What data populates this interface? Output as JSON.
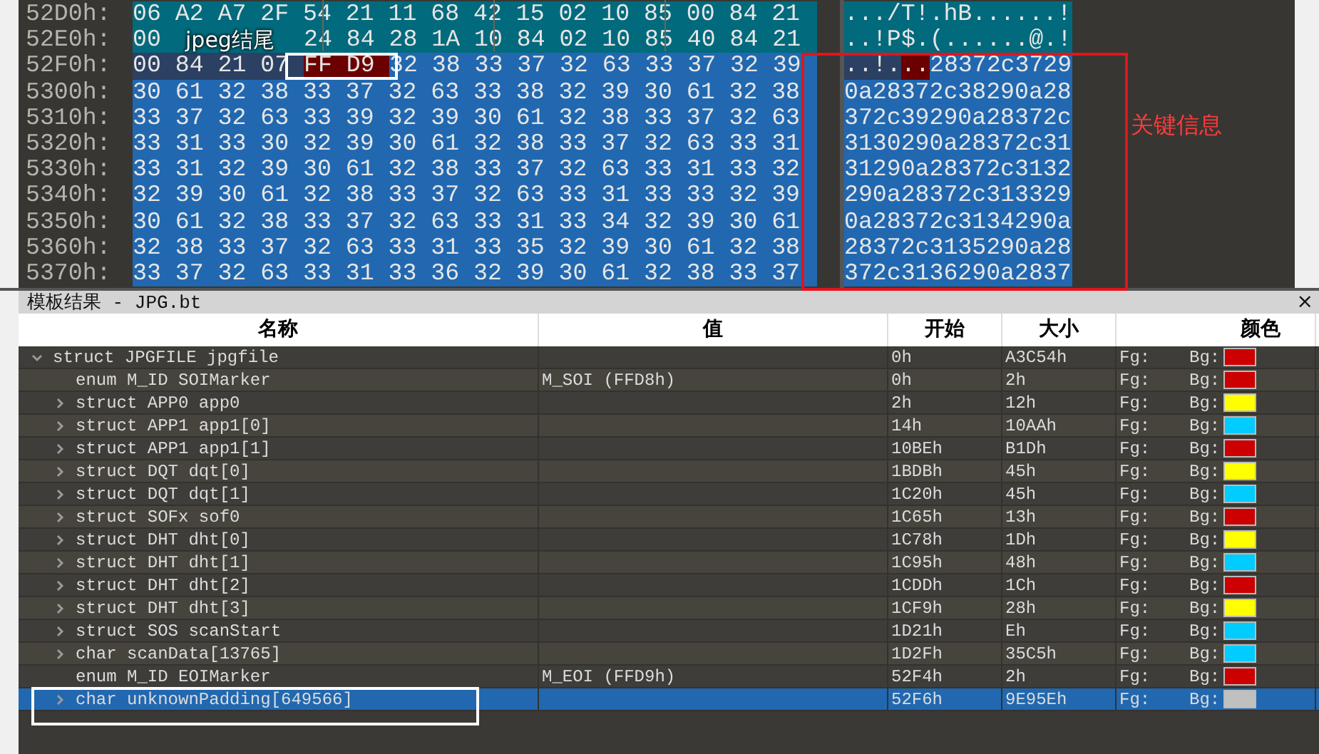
{
  "hex_view": {
    "rows": [
      {
        "address": "52D0h:",
        "segments": [
          {
            "kind": "struct",
            "hex": "06 A2 A7 2F 54 21 11 68 42 15 02 10 85 00 84 21",
            "ascii": ".../T!.hB......!"
          }
        ]
      },
      {
        "address": "52E0h:",
        "segments": [
          {
            "kind": "struct",
            "hex": "00",
            "ascii": "..!P"
          },
          {
            "kind": "struct",
            "hex": "24 84 28 1A 10 84 02 10 85 40 84 21",
            "ascii": "$.(......@.!"
          }
        ]
      },
      {
        "address": "52F0h:",
        "segments": [
          {
            "kind": "cursor",
            "hex": "00 84 21 07",
            "ascii": "..!."
          },
          {
            "kind": "marker",
            "hex": "FF D9",
            "ascii": ".."
          },
          {
            "kind": "selected",
            "hex": "32 38 33 37 32 63 33 37 32 39",
            "ascii": "28372c3729"
          }
        ]
      },
      {
        "address": "5300h:",
        "segments": [
          {
            "kind": "selected",
            "hex": "30 61 32 38 33 37 32 63 33 38 32 39 30 61 32 38",
            "ascii": "0a28372c38290a28"
          }
        ]
      },
      {
        "address": "5310h:",
        "segments": [
          {
            "kind": "selected",
            "hex": "33 37 32 63 33 39 32 39 30 61 32 38 33 37 32 63",
            "ascii": "372c39290a28372c"
          }
        ]
      },
      {
        "address": "5320h:",
        "segments": [
          {
            "kind": "selected",
            "hex": "33 31 33 30 32 39 30 61 32 38 33 37 32 63 33 31",
            "ascii": "3130290a28372c31"
          }
        ]
      },
      {
        "address": "5330h:",
        "segments": [
          {
            "kind": "selected",
            "hex": "33 31 32 39 30 61 32 38 33 37 32 63 33 31 33 32",
            "ascii": "31290a28372c3132"
          }
        ]
      },
      {
        "address": "5340h:",
        "segments": [
          {
            "kind": "selected",
            "hex": "32 39 30 61 32 38 33 37 32 63 33 31 33 33 32 39",
            "ascii": "290a28372c313329"
          }
        ]
      },
      {
        "address": "5350h:",
        "segments": [
          {
            "kind": "selected",
            "hex": "30 61 32 38 33 37 32 63 33 31 33 34 32 39 30 61",
            "ascii": "0a28372c3134290a"
          }
        ]
      },
      {
        "address": "5360h:",
        "segments": [
          {
            "kind": "selected",
            "hex": "32 38 33 37 32 63 33 31 33 35 32 39 30 61 32 38",
            "ascii": "28372c3135290a28"
          }
        ]
      },
      {
        "address": "5370h:",
        "segments": [
          {
            "kind": "selected",
            "hex": "33 37 32 63 33 31 33 36 32 39 30 61 32 38 33 37",
            "ascii": "372c3136290a2837"
          }
        ]
      }
    ]
  },
  "annotations": {
    "end_label": "jpeg结尾",
    "key_label": "关键信息"
  },
  "template_results": {
    "title": "模板结果 - JPG.bt",
    "close": "×",
    "columns": [
      "名称",
      "值",
      "开始",
      "大小",
      "颜色"
    ],
    "tree": [
      {
        "name": "struct JPGFILE jpgfile",
        "start": "0h",
        "size": "A3C54h",
        "fg": "Fg:",
        "bg": "Bg:",
        "color": "#cc0000",
        "expanded": true,
        "selected": false,
        "children": [
          {
            "name": "enum M_ID SOIMarker",
            "value": "M_SOI (FFD8h)",
            "start": "0h",
            "size": "2h",
            "fg": "Fg:",
            "bg": "Bg:",
            "color": "#cc0000",
            "selected": false
          },
          {
            "name": "struct APP0 app0",
            "start": "2h",
            "size": "12h",
            "fg": "Fg:",
            "bg": "Bg:",
            "color": "#ffff00",
            "expanded": false,
            "selected": false
          },
          {
            "name": "struct APP1 app1[0]",
            "start": "14h",
            "size": "10AAh",
            "fg": "Fg:",
            "bg": "Bg:",
            "color": "#00ccff",
            "expanded": false,
            "selected": false
          },
          {
            "name": "struct APP1 app1[1]",
            "start": "10BEh",
            "size": "B1Dh",
            "fg": "Fg:",
            "bg": "Bg:",
            "color": "#cc0000",
            "expanded": false,
            "selected": false
          },
          {
            "name": "struct DQT dqt[0]",
            "start": "1BDBh",
            "size": "45h",
            "fg": "Fg:",
            "bg": "Bg:",
            "color": "#ffff00",
            "expanded": false,
            "selected": false
          },
          {
            "name": "struct DQT dqt[1]",
            "start": "1C20h",
            "size": "45h",
            "fg": "Fg:",
            "bg": "Bg:",
            "color": "#00ccff",
            "expanded": false,
            "selected": false
          },
          {
            "name": "struct SOFx sof0",
            "start": "1C65h",
            "size": "13h",
            "fg": "Fg:",
            "bg": "Bg:",
            "color": "#cc0000",
            "expanded": false,
            "selected": false
          },
          {
            "name": "struct DHT dht[0]",
            "start": "1C78h",
            "size": "1Dh",
            "fg": "Fg:",
            "bg": "Bg:",
            "color": "#ffff00",
            "expanded": false,
            "selected": false
          },
          {
            "name": "struct DHT dht[1]",
            "start": "1C95h",
            "size": "48h",
            "fg": "Fg:",
            "bg": "Bg:",
            "color": "#00ccff",
            "expanded": false,
            "selected": false
          },
          {
            "name": "struct DHT dht[2]",
            "start": "1CDDh",
            "size": "1Ch",
            "fg": "Fg:",
            "bg": "Bg:",
            "color": "#cc0000",
            "expanded": false,
            "selected": false
          },
          {
            "name": "struct DHT dht[3]",
            "start": "1CF9h",
            "size": "28h",
            "fg": "Fg:",
            "bg": "Bg:",
            "color": "#ffff00",
            "expanded": false,
            "selected": false
          },
          {
            "name": "struct SOS scanStart",
            "start": "1D21h",
            "size": "Eh",
            "fg": "Fg:",
            "bg": "Bg:",
            "color": "#00ccff",
            "expanded": false,
            "selected": false
          },
          {
            "name": "char scanData[13765]",
            "start": "1D2Fh",
            "size": "35C5h",
            "fg": "Fg:",
            "bg": "Bg:",
            "color": "#00ccff",
            "expanded": false,
            "selected": false
          },
          {
            "name": "enum M_ID EOIMarker",
            "value": "M_EOI (FFD9h)",
            "start": "52F4h",
            "size": "2h",
            "fg": "Fg:",
            "bg": "Bg:",
            "color": "#cc0000",
            "selected": false
          },
          {
            "name": "char unknownPadding[649566]",
            "start": "52F6h",
            "size": "9E95Eh",
            "fg": "Fg:",
            "bg": "Bg:",
            "color": "#c0c0c0",
            "expanded": false,
            "selected": true
          }
        ]
      }
    ]
  }
}
